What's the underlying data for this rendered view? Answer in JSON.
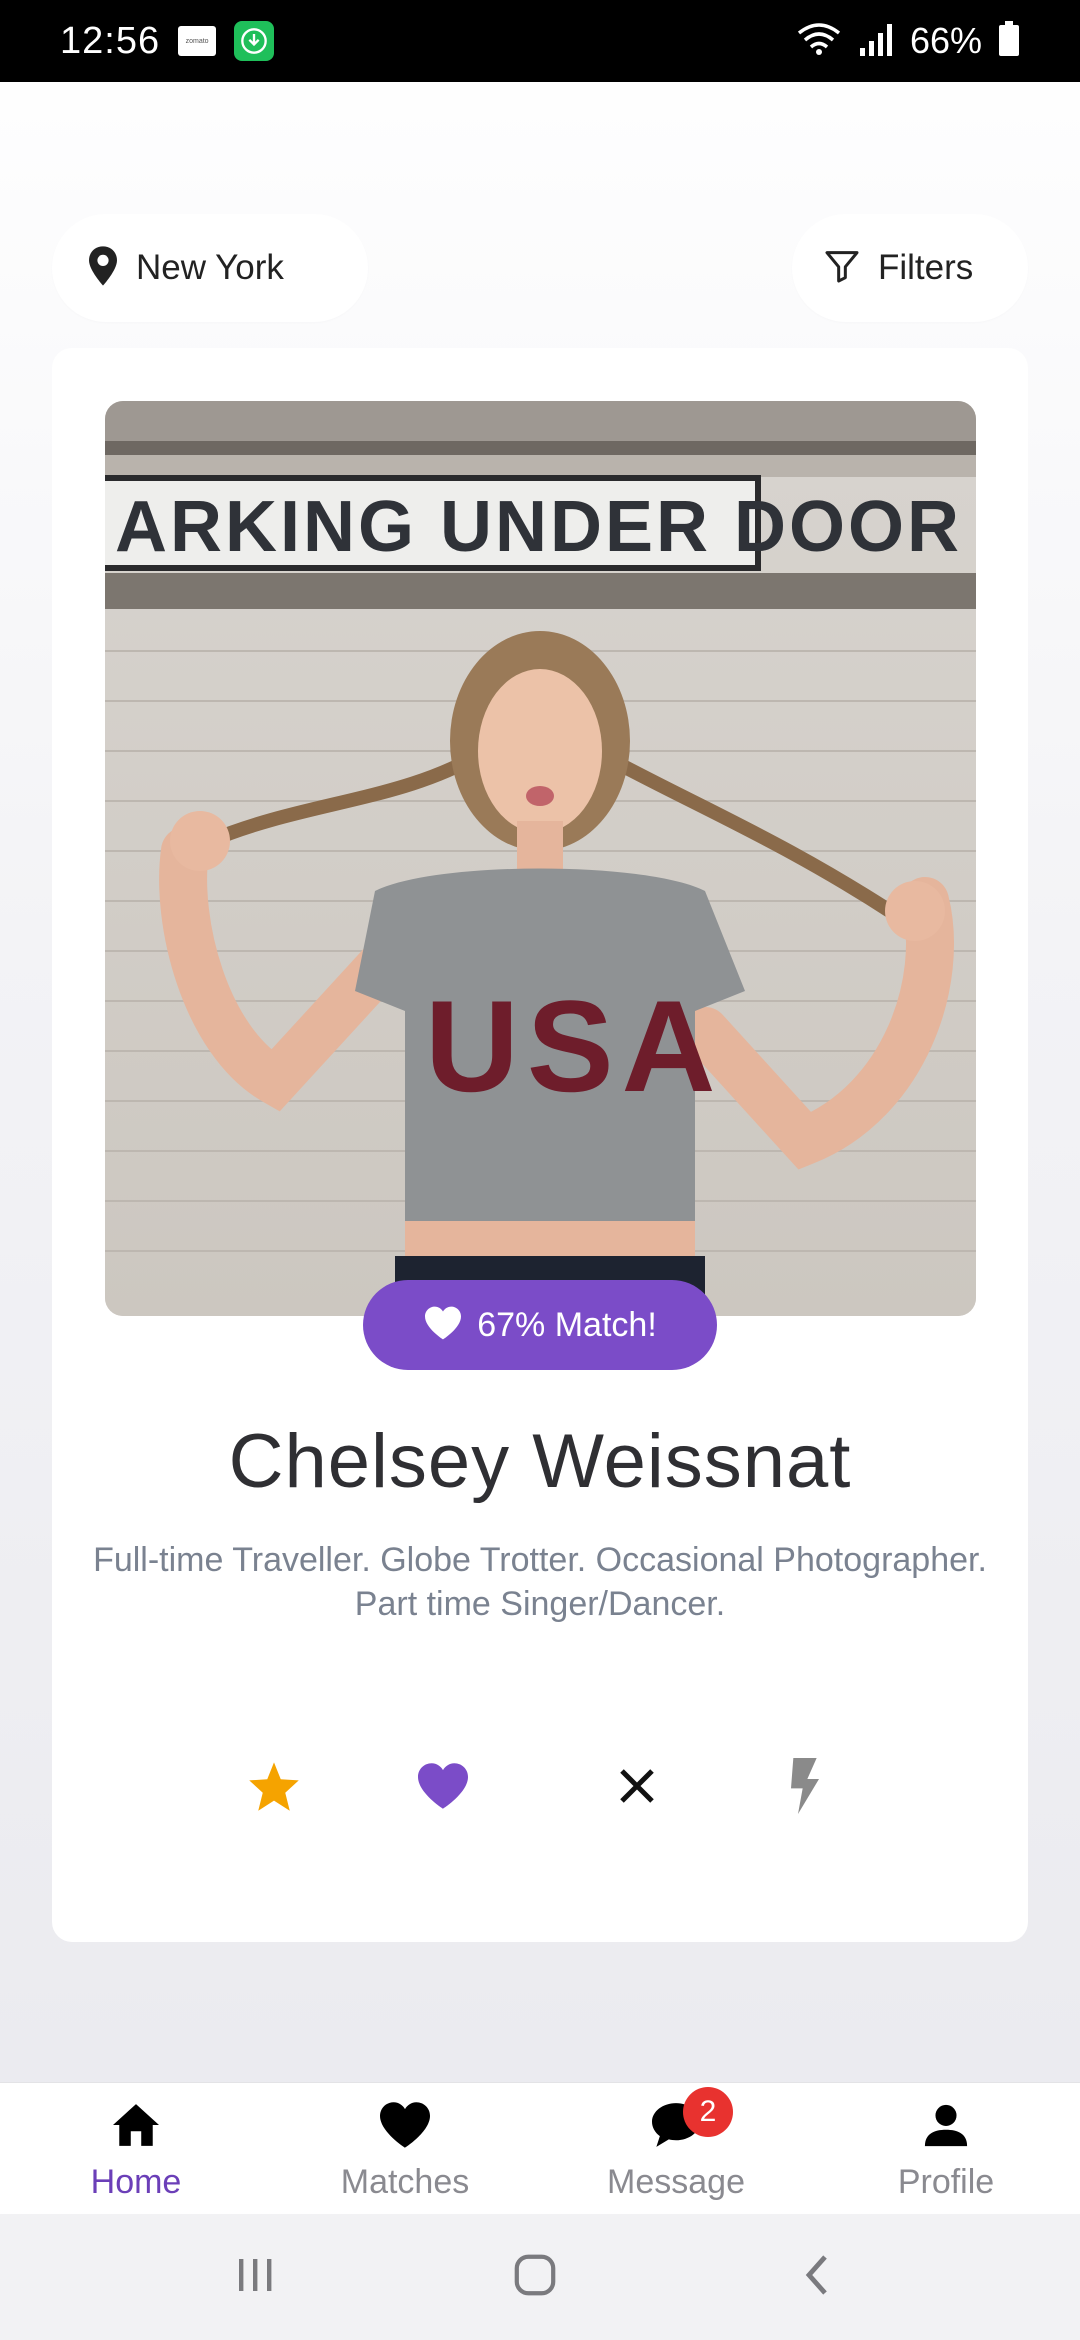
{
  "status_bar": {
    "time": "12:56",
    "notif_zomato": "zomato",
    "battery": "66%"
  },
  "location": {
    "label": "New York",
    "icon": "map-pin-icon"
  },
  "filters": {
    "label": "Filters",
    "icon": "filter-funnel-icon"
  },
  "profile": {
    "photo_sign_text": "ARKING UNDER DOOR",
    "shirt_text": "USA",
    "match": "67% Match!",
    "name": "Chelsey Weissnat",
    "bio_line1": "Full-time Traveller. Globe Trotter. Occasional Photographer.",
    "bio_line2": "Part time Singer/Dancer."
  },
  "actions": [
    {
      "name": "star",
      "icon": "star-icon",
      "color": "#f5a300"
    },
    {
      "name": "like",
      "icon": "heart-icon",
      "color": "#7b4cc8"
    },
    {
      "name": "dislike",
      "icon": "close-icon",
      "color": "#111111"
    },
    {
      "name": "boost",
      "icon": "lightning-icon",
      "color": "#8a8a8a"
    }
  ],
  "bottom_nav": {
    "items": [
      {
        "label": "Home",
        "icon": "home-icon",
        "active": true
      },
      {
        "label": "Matches",
        "icon": "heart-icon",
        "active": false
      },
      {
        "label": "Message",
        "icon": "chat-bubble-icon",
        "badge": "2",
        "active": false
      },
      {
        "label": "Profile",
        "icon": "user-icon",
        "active": false
      }
    ]
  },
  "colors": {
    "accent": "#7b4cc8",
    "active_nav": "#6b3fb8",
    "badge": "#e8322f",
    "star": "#f5a300"
  }
}
